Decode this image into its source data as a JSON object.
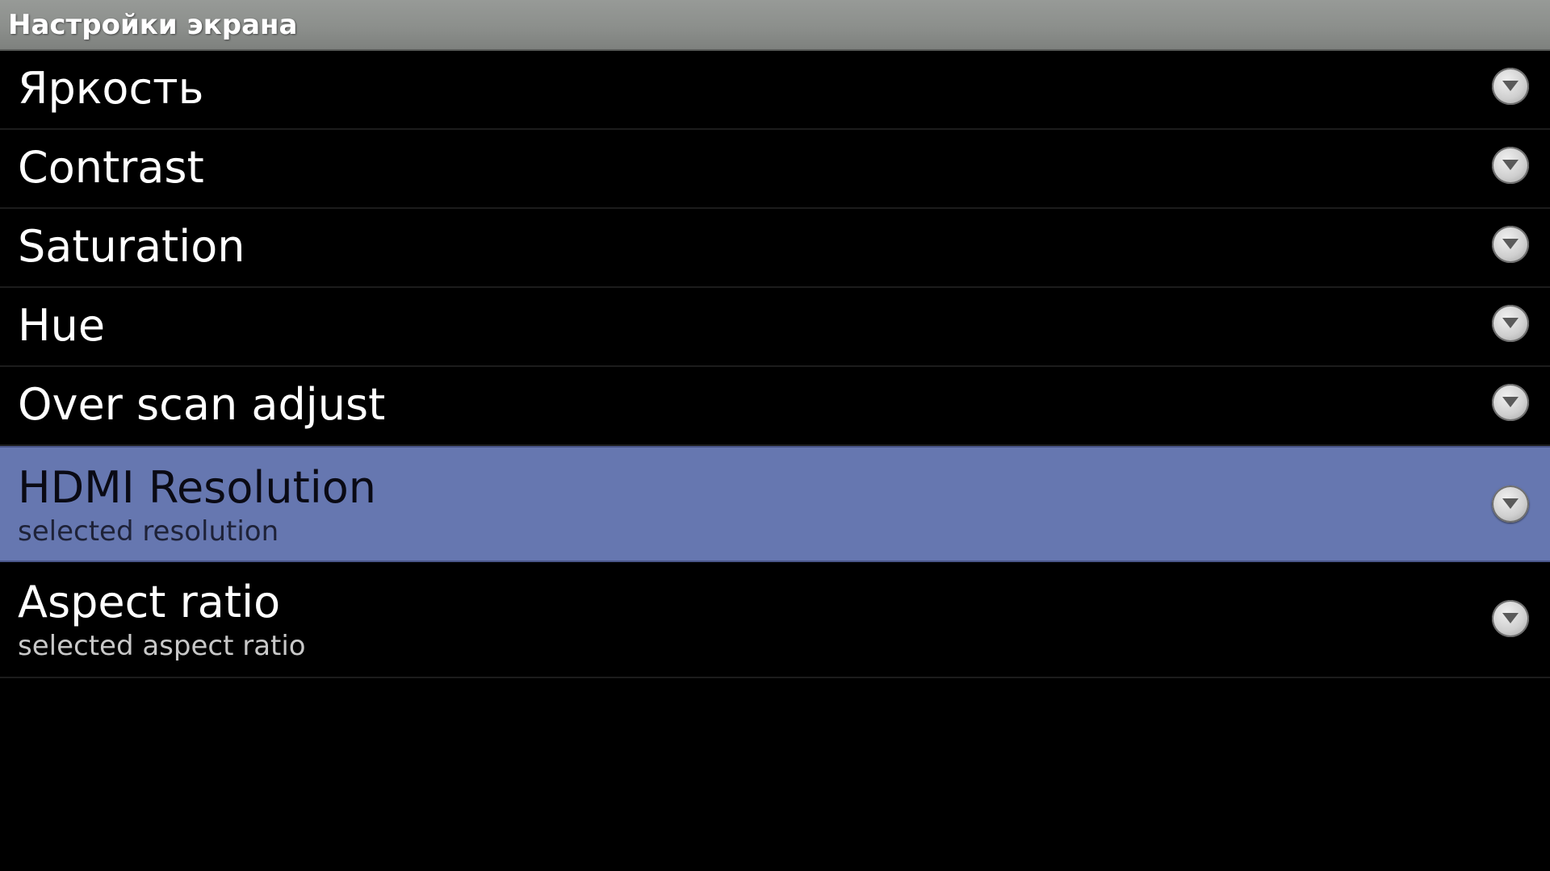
{
  "window": {
    "title": "Настройки экрана"
  },
  "settings": {
    "items": [
      {
        "title": "Яркость",
        "summary": ""
      },
      {
        "title": "Contrast",
        "summary": ""
      },
      {
        "title": "Saturation",
        "summary": ""
      },
      {
        "title": "Hue",
        "summary": ""
      },
      {
        "title": "Over scan adjust",
        "summary": ""
      },
      {
        "title": "HDMI Resolution",
        "summary": "selected resolution",
        "selected": true
      },
      {
        "title": "Aspect ratio",
        "summary": "selected aspect ratio"
      }
    ],
    "item_icon": "chevron-down-circle-icon"
  },
  "colors": {
    "background": "#000000",
    "titlebar": "#8c8f8c",
    "selected_highlight": "#6677b0",
    "text": "#ffffff"
  }
}
